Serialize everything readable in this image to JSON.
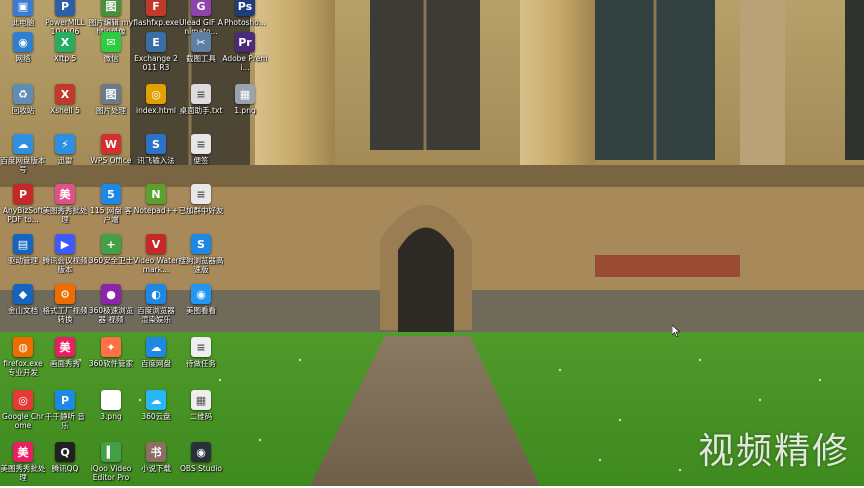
{
  "desktop": {
    "watermark": "视频精修",
    "icons": [
      {
        "label": "此电脑",
        "icon": "computer-icon",
        "color": "#3a7bd5",
        "glyph": "▣"
      },
      {
        "label": "PowerMILL 10.0.06",
        "icon": "powermill-icon",
        "color": "#2b5fa8",
        "glyph": "P"
      },
      {
        "label": "图片编辑 myhtjp录像",
        "icon": "image-editor-icon",
        "color": "#4a8f3a",
        "glyph": "图"
      },
      {
        "label": "flashfxp.exe",
        "icon": "flashfxp-icon",
        "color": "#c0392b",
        "glyph": "F"
      },
      {
        "label": "Ulead GIF Animato...",
        "icon": "ulead-gif-icon",
        "color": "#8e44ad",
        "glyph": "G"
      },
      {
        "label": "Photosho...",
        "icon": "photoshop-icon",
        "color": "#1f3d7a",
        "glyph": "Ps"
      },
      {
        "label": "网络",
        "icon": "network-icon",
        "color": "#2f7fd1",
        "glyph": "◉"
      },
      {
        "label": "Xftp 5",
        "icon": "xftp-icon",
        "color": "#27ae60",
        "glyph": "X"
      },
      {
        "label": "微信",
        "icon": "wechat-icon",
        "color": "#2ecc40",
        "glyph": "✉"
      },
      {
        "label": "Exchange 2011 R3",
        "icon": "exchange-icon",
        "color": "#3a6ea5",
        "glyph": "E"
      },
      {
        "label": "截图工具",
        "icon": "snipping-tool-icon",
        "color": "#5d7fa3",
        "glyph": "✂"
      },
      {
        "label": "Adobe Premi...",
        "icon": "premiere-icon",
        "color": "#4b2a7a",
        "glyph": "Pr"
      },
      {
        "label": "回收站",
        "icon": "recycle-bin-icon",
        "color": "#5f8db5",
        "glyph": "♻"
      },
      {
        "label": "Xshell 5",
        "icon": "xshell-icon",
        "color": "#c0392b",
        "glyph": "X"
      },
      {
        "label": "图片处理",
        "icon": "image-process-icon",
        "color": "#6c7a89",
        "glyph": "图"
      },
      {
        "label": "index.html",
        "icon": "chrome-html-icon",
        "color": "#e0a100",
        "glyph": "◎"
      },
      {
        "label": "桌面助手.txt",
        "icon": "text-file-icon",
        "color": "#dcdcdc",
        "glyph": "≡"
      },
      {
        "label": "1.png",
        "icon": "png-file-icon",
        "color": "#9aa3ad",
        "glyph": "▦"
      },
      {
        "label": "百度网盘版本号",
        "icon": "baidu-netdisk-icon",
        "color": "#2f8fe0",
        "glyph": "☁"
      },
      {
        "label": "迅雷",
        "icon": "thunder-icon",
        "color": "#2d8fe4",
        "glyph": "⚡"
      },
      {
        "label": "WPS Office",
        "icon": "wps-icon",
        "color": "#d32f2f",
        "glyph": "W"
      },
      {
        "label": "讯飞输入法",
        "icon": "iflytek-icon",
        "color": "#2d72c7",
        "glyph": "S"
      },
      {
        "label": "便签",
        "icon": "sticky-note-icon",
        "color": "#e6e6e6",
        "glyph": "≡"
      },
      {
        "label": "AnyBizSoft PDF to...",
        "icon": "pdf-converter-icon",
        "color": "#c62828",
        "glyph": "P"
      },
      {
        "label": "美图秀秀批处理",
        "icon": "meitu-batch-icon",
        "color": "#e0508a",
        "glyph": "美"
      },
      {
        "label": "115 网盘 客户端",
        "icon": "115-netdisk-icon",
        "color": "#1e88e5",
        "glyph": "5"
      },
      {
        "label": "Notepad++",
        "icon": "notepad-plus-icon",
        "color": "#5aa02c",
        "glyph": "N"
      },
      {
        "label": "已加群中好友",
        "icon": "group-doc-icon",
        "color": "#e8e8e8",
        "glyph": "≡"
      },
      {
        "label": "驱动管理",
        "icon": "driver-manager-icon",
        "color": "#1565c0",
        "glyph": "▤"
      },
      {
        "label": "腾讯会议视频版本",
        "icon": "tencent-video-icon",
        "color": "#3d5afe",
        "glyph": "▶"
      },
      {
        "label": "360安全卫士",
        "icon": "360-safe-icon",
        "color": "#43a047",
        "glyph": "+"
      },
      {
        "label": "Video Watermark...",
        "icon": "video-watermark-icon",
        "color": "#c62828",
        "glyph": "V"
      },
      {
        "label": "搜狗浏览器高速版",
        "icon": "sogou-browser-icon",
        "color": "#1e88e5",
        "glyph": "S"
      },
      {
        "label": "金山文档",
        "icon": "kingsoft-doc-icon",
        "color": "#1565c0",
        "glyph": "◆"
      },
      {
        "label": "格式工厂视频转换",
        "icon": "format-factory-icon",
        "color": "#ef6c00",
        "glyph": "⚙"
      },
      {
        "label": "360极速浏览器 视频",
        "icon": "360-browser-icon",
        "color": "#8e24aa",
        "glyph": "●"
      },
      {
        "label": "百度浏览器 渲染娱乐",
        "icon": "baidu-browser-icon",
        "color": "#1e88e5",
        "glyph": "◐"
      },
      {
        "label": "美图看看",
        "icon": "meitu-viewer-icon",
        "color": "#2196f3",
        "glyph": "◉"
      },
      {
        "label": "firefox.exe 专业开发",
        "icon": "firefox-icon",
        "color": "#ef6c00",
        "glyph": "◍"
      },
      {
        "label": "画面秀秀",
        "icon": "meitu-xiuxiu-icon",
        "color": "#e91e63",
        "glyph": "美"
      },
      {
        "label": "360软件管家",
        "icon": "360-software-icon",
        "color": "#ff7043",
        "glyph": "✦"
      },
      {
        "label": "百度网盘",
        "icon": "baidu-pan-icon",
        "color": "#1e88e5",
        "glyph": "☁"
      },
      {
        "label": "待做任务",
        "icon": "todo-doc-icon",
        "color": "#eeeeee",
        "glyph": "≡"
      },
      {
        "label": "Google Chrome",
        "icon": "chrome-icon",
        "color": "#e53935",
        "glyph": "◎"
      },
      {
        "label": "千千静听 音乐",
        "icon": "qianqian-icon",
        "color": "#1e88e5",
        "glyph": "P"
      },
      {
        "label": "3.png",
        "icon": "png-blank-icon",
        "color": "#ffffff",
        "glyph": " "
      },
      {
        "label": "360云盘",
        "icon": "360-cloud-icon",
        "color": "#29b6f6",
        "glyph": "☁"
      },
      {
        "label": "二维码",
        "icon": "qr-code-icon",
        "color": "#eeeeee",
        "glyph": "▦"
      },
      {
        "label": "美图秀秀批处理",
        "icon": "meitu-batch2-icon",
        "color": "#e91e63",
        "glyph": "美"
      },
      {
        "label": "腾讯QQ",
        "icon": "qq-icon",
        "color": "#212121",
        "glyph": "Q"
      },
      {
        "label": "iQoo Video Editor Pro",
        "icon": "video-editor-icon",
        "color": "#43a047",
        "glyph": "▍"
      },
      {
        "label": "小说下载",
        "icon": "novel-download-icon",
        "color": "#8d6e63",
        "glyph": "书"
      },
      {
        "label": "OBS Studio",
        "icon": "obs-icon",
        "color": "#263238",
        "glyph": "◉"
      }
    ]
  }
}
